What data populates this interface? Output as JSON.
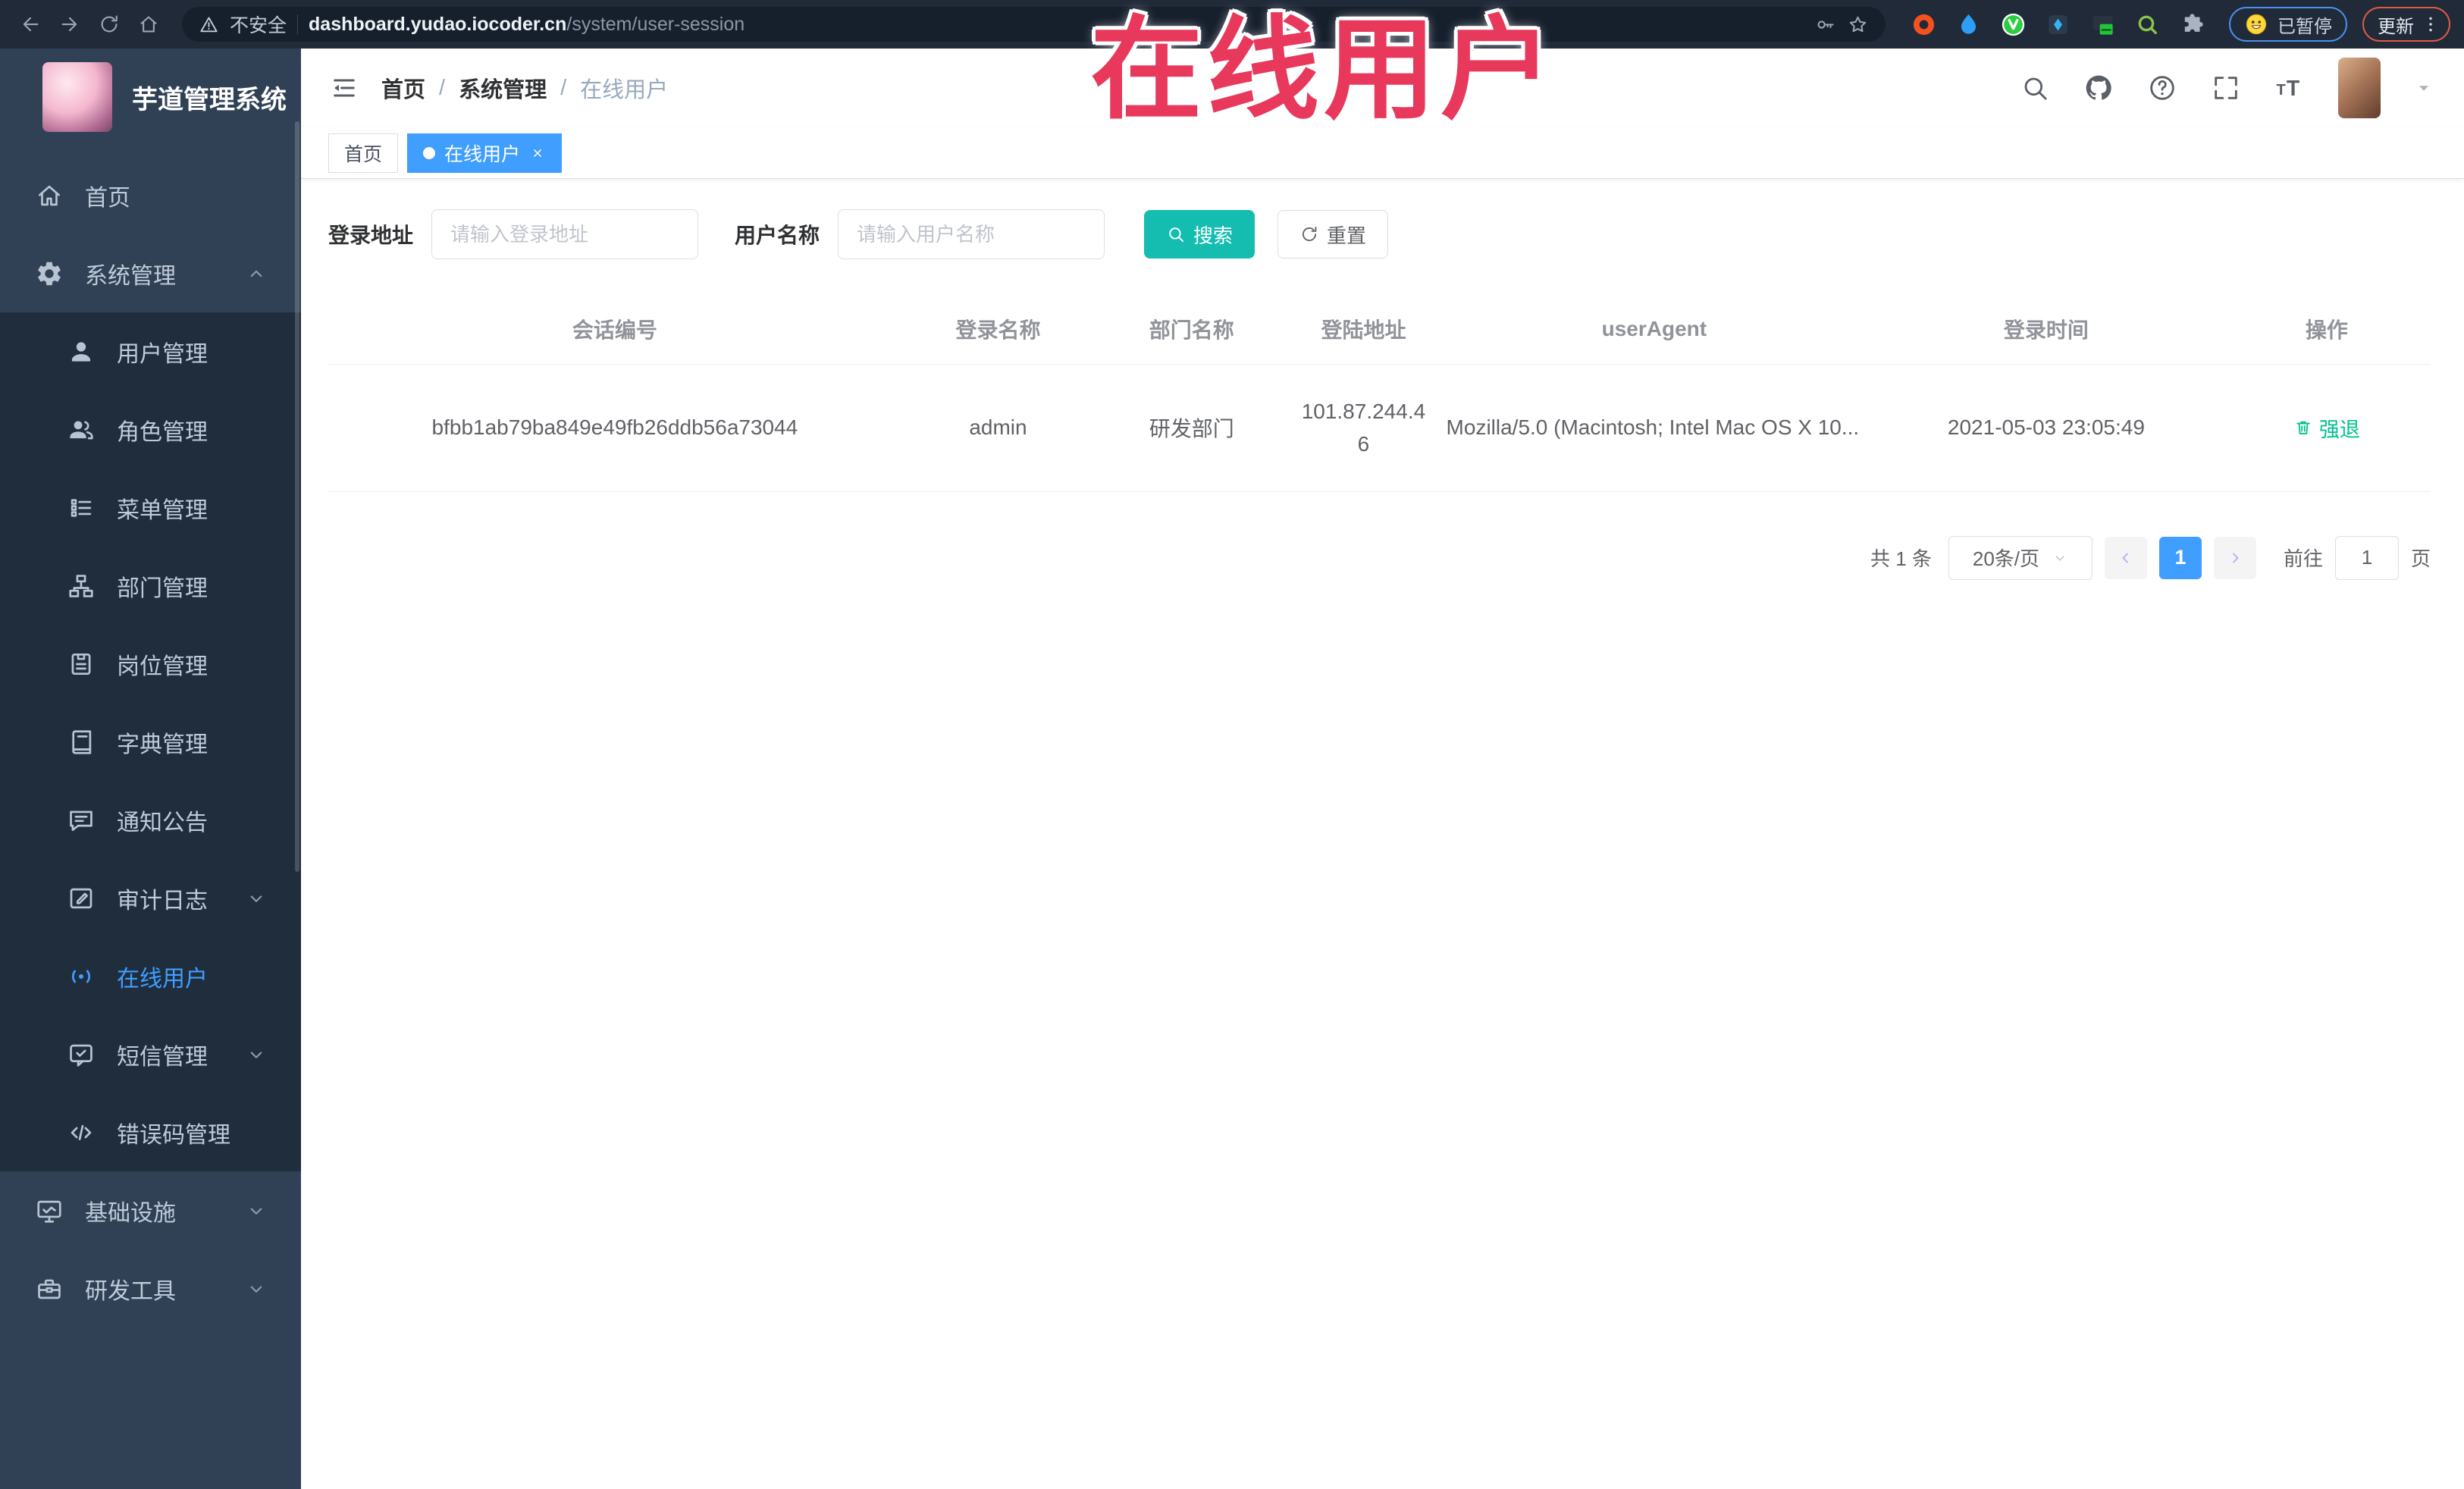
{
  "watermark": "在线用户",
  "browser": {
    "security_label": "不安全",
    "url_host": "dashboard.yudao.iocoder.cn",
    "url_path": "/system/user-session",
    "paused_badge": "已暂停",
    "update_button": "更新"
  },
  "sidebar": {
    "title": "芋道管理系统",
    "items": [
      {
        "label": "首页",
        "icon": "home"
      },
      {
        "label": "系统管理",
        "icon": "gear",
        "chevron": "up"
      },
      {
        "label": "用户管理",
        "icon": "user"
      },
      {
        "label": "角色管理",
        "icon": "users"
      },
      {
        "label": "菜单管理",
        "icon": "menu-list"
      },
      {
        "label": "部门管理",
        "icon": "org-tree"
      },
      {
        "label": "岗位管理",
        "icon": "badge"
      },
      {
        "label": "字典管理",
        "icon": "book"
      },
      {
        "label": "通知公告",
        "icon": "announce"
      },
      {
        "label": "审计日志",
        "icon": "log",
        "chevron": "down"
      },
      {
        "label": "在线用户",
        "icon": "online",
        "active": true
      },
      {
        "label": "短信管理",
        "icon": "sms",
        "chevron": "down"
      },
      {
        "label": "错误码管理",
        "icon": "code"
      },
      {
        "label": "基础设施",
        "icon": "monitor",
        "chevron": "down"
      },
      {
        "label": "研发工具",
        "icon": "toolbox",
        "chevron": "down"
      }
    ]
  },
  "header": {
    "breadcrumb": [
      "首页",
      "系统管理",
      "在线用户"
    ],
    "separator": "/"
  },
  "tabs": [
    {
      "label": "首页"
    },
    {
      "label": "在线用户"
    }
  ],
  "filters": {
    "login_address_label": "登录地址",
    "login_address_placeholder": "请输入登录地址",
    "username_label": "用户名称",
    "username_placeholder": "请输入用户名称",
    "search_button": "搜索",
    "reset_button": "重置"
  },
  "table": {
    "columns": [
      "会话编号",
      "登录名称",
      "部门名称",
      "登陆地址",
      "userAgent",
      "登录时间",
      "操作"
    ],
    "rows": [
      {
        "session_id": "bfbb1ab79ba849e49fb26ddb56a73044",
        "login_name": "admin",
        "dept_name": "研发部门",
        "login_address": "101.87.244.46",
        "user_agent": "Mozilla/5.0 (Macintosh; Intel Mac OS X 10...",
        "login_time": "2021-05-03 23:05:49",
        "action_label": "强退"
      }
    ]
  },
  "pagination": {
    "total": "共 1 条",
    "page_size": "20条/页",
    "current_page": "1",
    "goto_label": "前往",
    "goto_value": "1",
    "goto_unit": "页"
  },
  "colors": {
    "accent_blue": "#409eff",
    "search_teal": "#14bdb0",
    "watermark_red": "#e8395c",
    "sidebar_bg": "#304156",
    "submenu_bg": "#1f2d3d",
    "force_logout_green": "#00c190"
  }
}
